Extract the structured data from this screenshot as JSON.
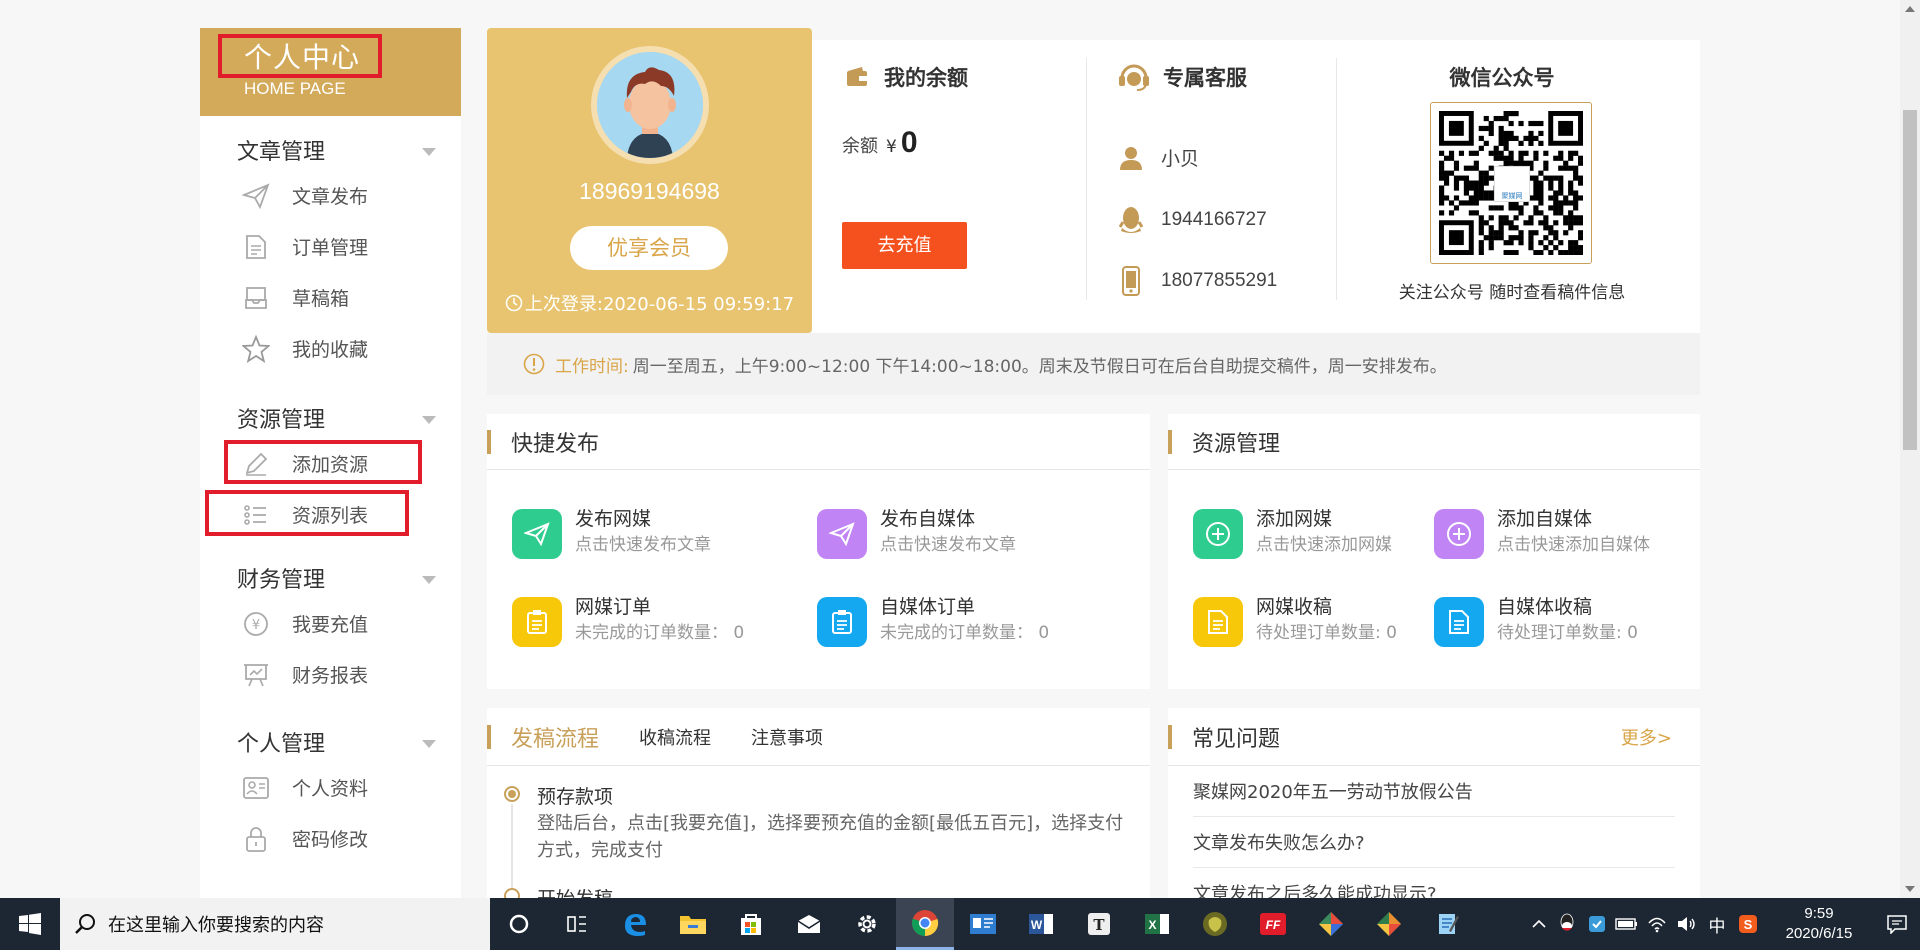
{
  "sidebar": {
    "title": "个人中心",
    "subtitle": "HOME PAGE",
    "groups": [
      {
        "label": "文章管理",
        "items": [
          {
            "label": "文章发布",
            "icon": "send-icon"
          },
          {
            "label": "订单管理",
            "icon": "document-icon"
          },
          {
            "label": "草稿箱",
            "icon": "inbox-icon"
          },
          {
            "label": "我的收藏",
            "icon": "star-icon"
          }
        ]
      },
      {
        "label": "资源管理",
        "items": [
          {
            "label": "添加资源",
            "icon": "pencil-icon"
          },
          {
            "label": "资源列表",
            "icon": "list-icon"
          }
        ]
      },
      {
        "label": "财务管理",
        "items": [
          {
            "label": "我要充值",
            "icon": "yen-icon"
          },
          {
            "label": "财务报表",
            "icon": "report-icon"
          }
        ]
      },
      {
        "label": "个人管理",
        "items": [
          {
            "label": "个人资料",
            "icon": "profile-card-icon"
          },
          {
            "label": "密码修改",
            "icon": "lock-icon"
          }
        ]
      }
    ]
  },
  "profile": {
    "phone": "18969194698",
    "membership": "优享会员",
    "last_login": "上次登录:2020-06-15 09:59:17"
  },
  "balance": {
    "title": "我的余额",
    "label": "余额",
    "currency": "¥",
    "amount": "0",
    "button": "去充值"
  },
  "service": {
    "title": "专属客服",
    "name": "小贝",
    "qq": "1944166727",
    "phone": "18077855291"
  },
  "wechat": {
    "title": "微信公众号",
    "caption": "关注公众号 随时查看稿件信息",
    "qr_center_text": "聚媒网"
  },
  "notice": {
    "label": "工作时间:",
    "text": "周一至周五，上午9:00~12:00 下午14:00~18:00。周末及节假日可在后台自助提交稿件，周一安排发布。"
  },
  "quick_publish": {
    "title": "快捷发布",
    "items": [
      {
        "title": "发布网媒",
        "desc": "点击快速发布文章",
        "color": "#2ecc8f"
      },
      {
        "title": "发布自媒体",
        "desc": "点击快速发布文章",
        "color": "#c084f5"
      },
      {
        "title": "网媒订单",
        "desc": "未完成的订单数量：  0",
        "color": "#f7c70a"
      },
      {
        "title": "自媒体订单",
        "desc": "未完成的订单数量：  0",
        "color": "#13a8f0"
      }
    ]
  },
  "resources": {
    "title": "资源管理",
    "items": [
      {
        "title": "添加网媒",
        "desc": "点击快速添加网媒",
        "color": "#2ecc8f"
      },
      {
        "title": "添加自媒体",
        "desc": "点击快速添加自媒体",
        "color": "#c084f5"
      },
      {
        "title": "网媒收稿",
        "desc": "待处理订单数量: 0",
        "color": "#f7c70a"
      },
      {
        "title": "自媒体收稿",
        "desc": "待处理订单数量: 0",
        "color": "#13a8f0"
      }
    ]
  },
  "process": {
    "tabs": [
      "发稿流程",
      "收稿流程",
      "注意事项"
    ],
    "steps": [
      {
        "title": "预存款项",
        "desc": "登陆后台，点击[我要充值]，选择要预充值的金额[最低五百元]，选择支付方式，完成支付"
      },
      {
        "title": "开始发稿",
        "desc": ""
      }
    ]
  },
  "faq": {
    "title": "常见问题",
    "more": "更多>",
    "items": [
      "聚媒网2020年五一劳动节放假公告",
      "文章发布失败怎么办?",
      "文章发布之后多久能成功显示?"
    ]
  },
  "taskbar": {
    "search_placeholder": "在这里输入你要搜索的内容",
    "ime": "中",
    "time": "9:59",
    "date": "2020/6/15",
    "icons": [
      "cortana-icon",
      "task-view-icon",
      "edge-icon",
      "file-explorer-icon",
      "store-icon",
      "mail-icon",
      "settings-icon",
      "chrome-icon",
      "contacts-icon",
      "word-icon",
      "typora-icon",
      "excel-icon",
      "game-icon",
      "flashfxp-icon",
      "app-icon",
      "app2-icon",
      "notepad-icon"
    ]
  },
  "colors": {
    "accent": "#d3a95a",
    "recharge": "#f4511e",
    "highlight": "#e21d2b"
  }
}
